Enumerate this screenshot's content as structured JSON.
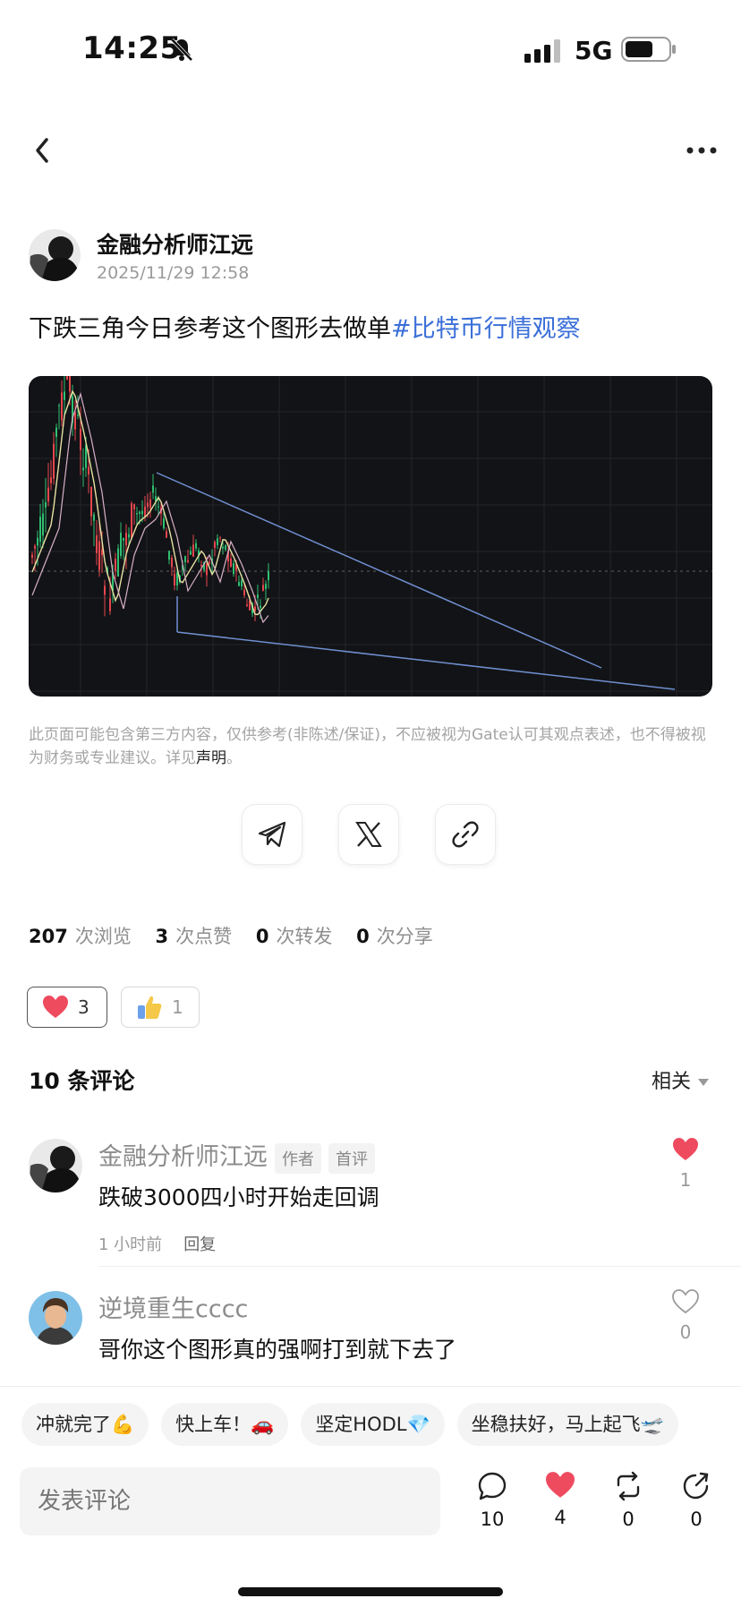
{
  "status_bar": {
    "time": "14:25",
    "network": "5G"
  },
  "post": {
    "author_name": "金融分析师江远",
    "timestamp": "2025/11/29 12:58",
    "text": "下跌三角今日参考这个图形去做单",
    "hashtag": "#比特币行情观察"
  },
  "disclaimer": {
    "text": "此页面可能包含第三方内容，仅供参考(非陈述/保证)，不应被视为Gate认可其观点表述，也不得被视为财务或专业建议。详见",
    "link": "声明",
    "end": "。"
  },
  "stats": {
    "views": "207",
    "views_label": "次浏览",
    "likes": "3",
    "likes_label": "次点赞",
    "reposts": "0",
    "reposts_label": "次转发",
    "shares": "0",
    "shares_label": "次分享"
  },
  "reactions": {
    "heart_count": "3",
    "thumb_count": "1"
  },
  "comments_section": {
    "title": "10 条评论",
    "sort_label": "相关",
    "items": [
      {
        "name": "金融分析师江远",
        "tags": [
          "作者",
          "首评"
        ],
        "text": "跌破3000四小时开始走回调",
        "time": "1 小时前",
        "reply": "回复",
        "likes": "1",
        "liked": true
      },
      {
        "name": "逆境重生cccc",
        "text": "哥你这个图形真的强啊打到就下去了",
        "likes": "0",
        "liked": false
      }
    ]
  },
  "quick_replies": [
    "冲就完了💪",
    "快上车！🚗",
    "坚定HODL💎",
    "坐稳扶好，马上起飞🛫"
  ],
  "input": {
    "placeholder": "发表评论"
  },
  "actions": {
    "comments": "10",
    "likes": "4",
    "reposts": "0",
    "shares": "0"
  },
  "colors": {
    "hashtag": "#3a6fd8",
    "heart": "#ee4b5f",
    "chart_bg": "#121316",
    "trend_line": "#6f8fd0"
  }
}
